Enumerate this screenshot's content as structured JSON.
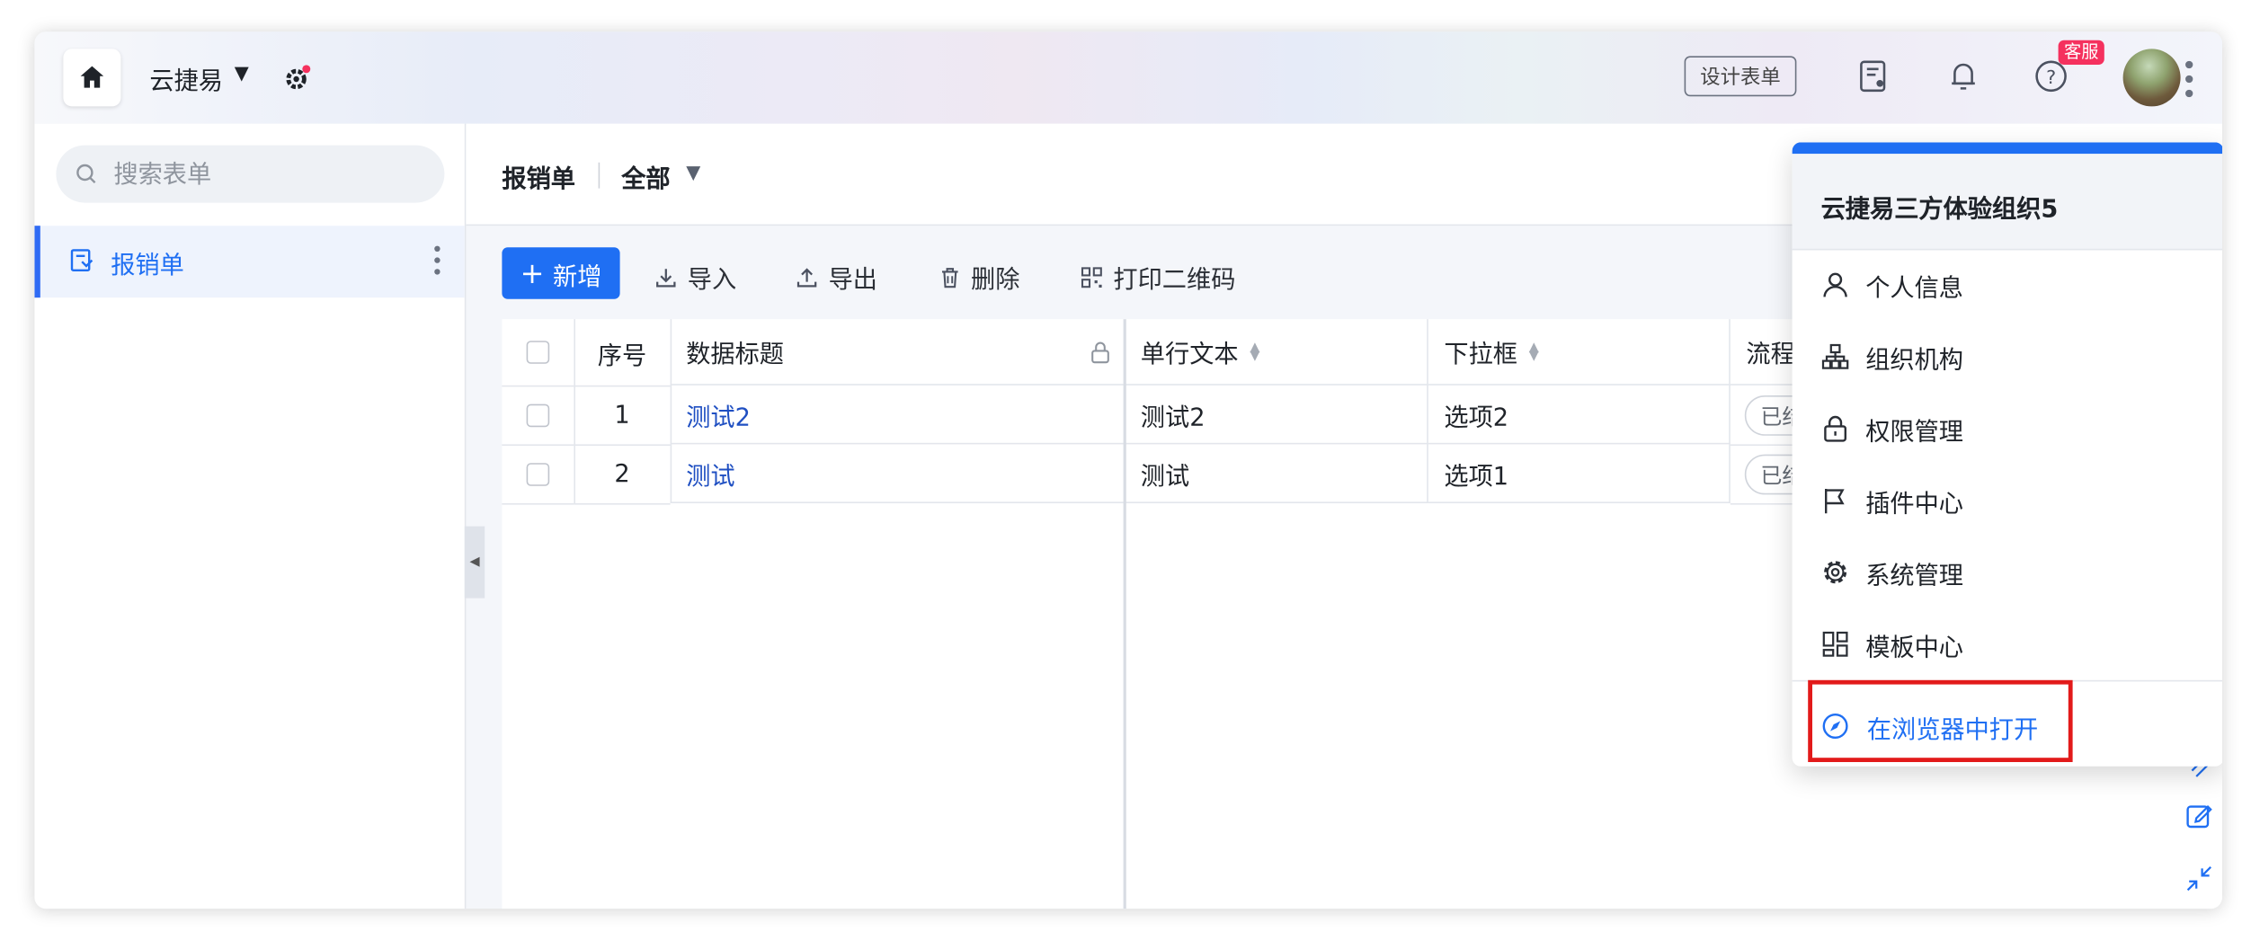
{
  "app": {
    "name": "云捷易"
  },
  "header": {
    "design_form": "设计表单",
    "service_badge": "客服"
  },
  "sidebar": {
    "search_placeholder": "搜索表单",
    "items": [
      {
        "label": "报销单"
      }
    ]
  },
  "breadcrumb": {
    "title": "报销单",
    "filter": "全部"
  },
  "toolbar": {
    "add": "新增",
    "import": "导入",
    "export": "导出",
    "delete": "删除",
    "print_qr": "打印二维码"
  },
  "table": {
    "columns": [
      "序号",
      "数据标题",
      "单行文本",
      "下拉框",
      "流程"
    ],
    "rows": [
      {
        "index": "1",
        "title": "测试2",
        "text": "测试2",
        "select": "选项2",
        "status": "已结"
      },
      {
        "index": "2",
        "title": "测试",
        "text": "测试",
        "select": "选项1",
        "status": "已结"
      }
    ]
  },
  "dropdown": {
    "org_name": "云捷易三方体验组织5",
    "items": [
      {
        "label": "个人信息",
        "icon": "user-icon"
      },
      {
        "label": "组织机构",
        "icon": "org-chart-icon"
      },
      {
        "label": "权限管理",
        "icon": "lock-icon"
      },
      {
        "label": "插件中心",
        "icon": "flag-icon"
      },
      {
        "label": "系统管理",
        "icon": "gear-icon"
      },
      {
        "label": "模板中心",
        "icon": "template-icon"
      }
    ],
    "open_in_browser": "在浏览器中打开"
  },
  "colors": {
    "accent": "#1f6ff3",
    "highlight": "#e21a1a",
    "badge": "#f5315e"
  }
}
